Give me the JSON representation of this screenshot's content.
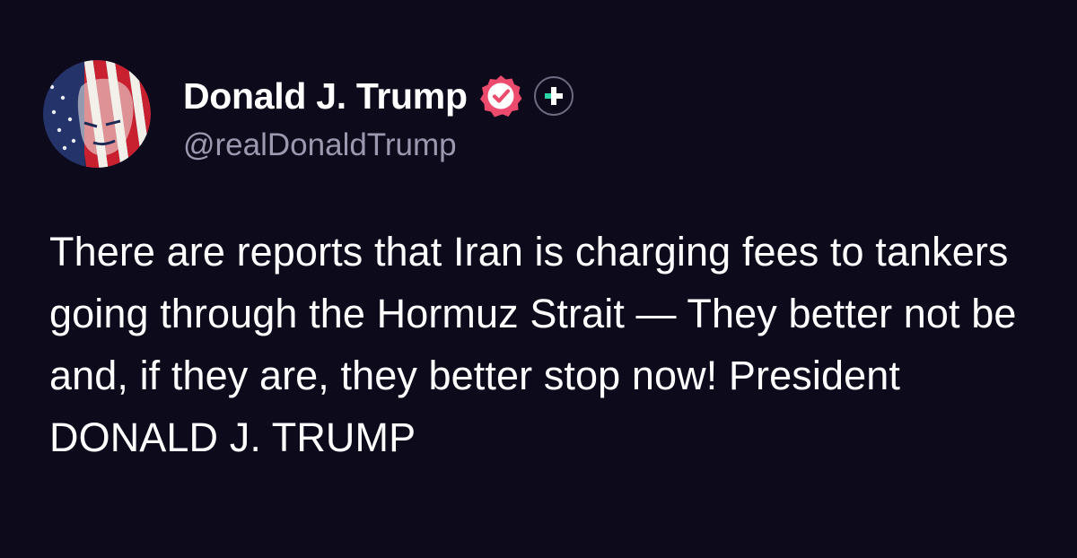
{
  "author": {
    "display_name": "Donald J. Trump",
    "handle": "@realDonaldTrump",
    "verified": true,
    "verified_color": "#ec4b6e"
  },
  "actions": {
    "follow_icon": "plus-icon",
    "follow_accent": "#2bd6a4"
  },
  "post": {
    "text": "There are reports that Iran is charging fees to tankers going through the Hormuz Strait — They better not be and, if they are, they better stop now! President DONALD J. TRUMP"
  },
  "colors": {
    "background": "#0d0a1c",
    "text": "#ffffff",
    "secondary_text": "#9c98b0"
  }
}
